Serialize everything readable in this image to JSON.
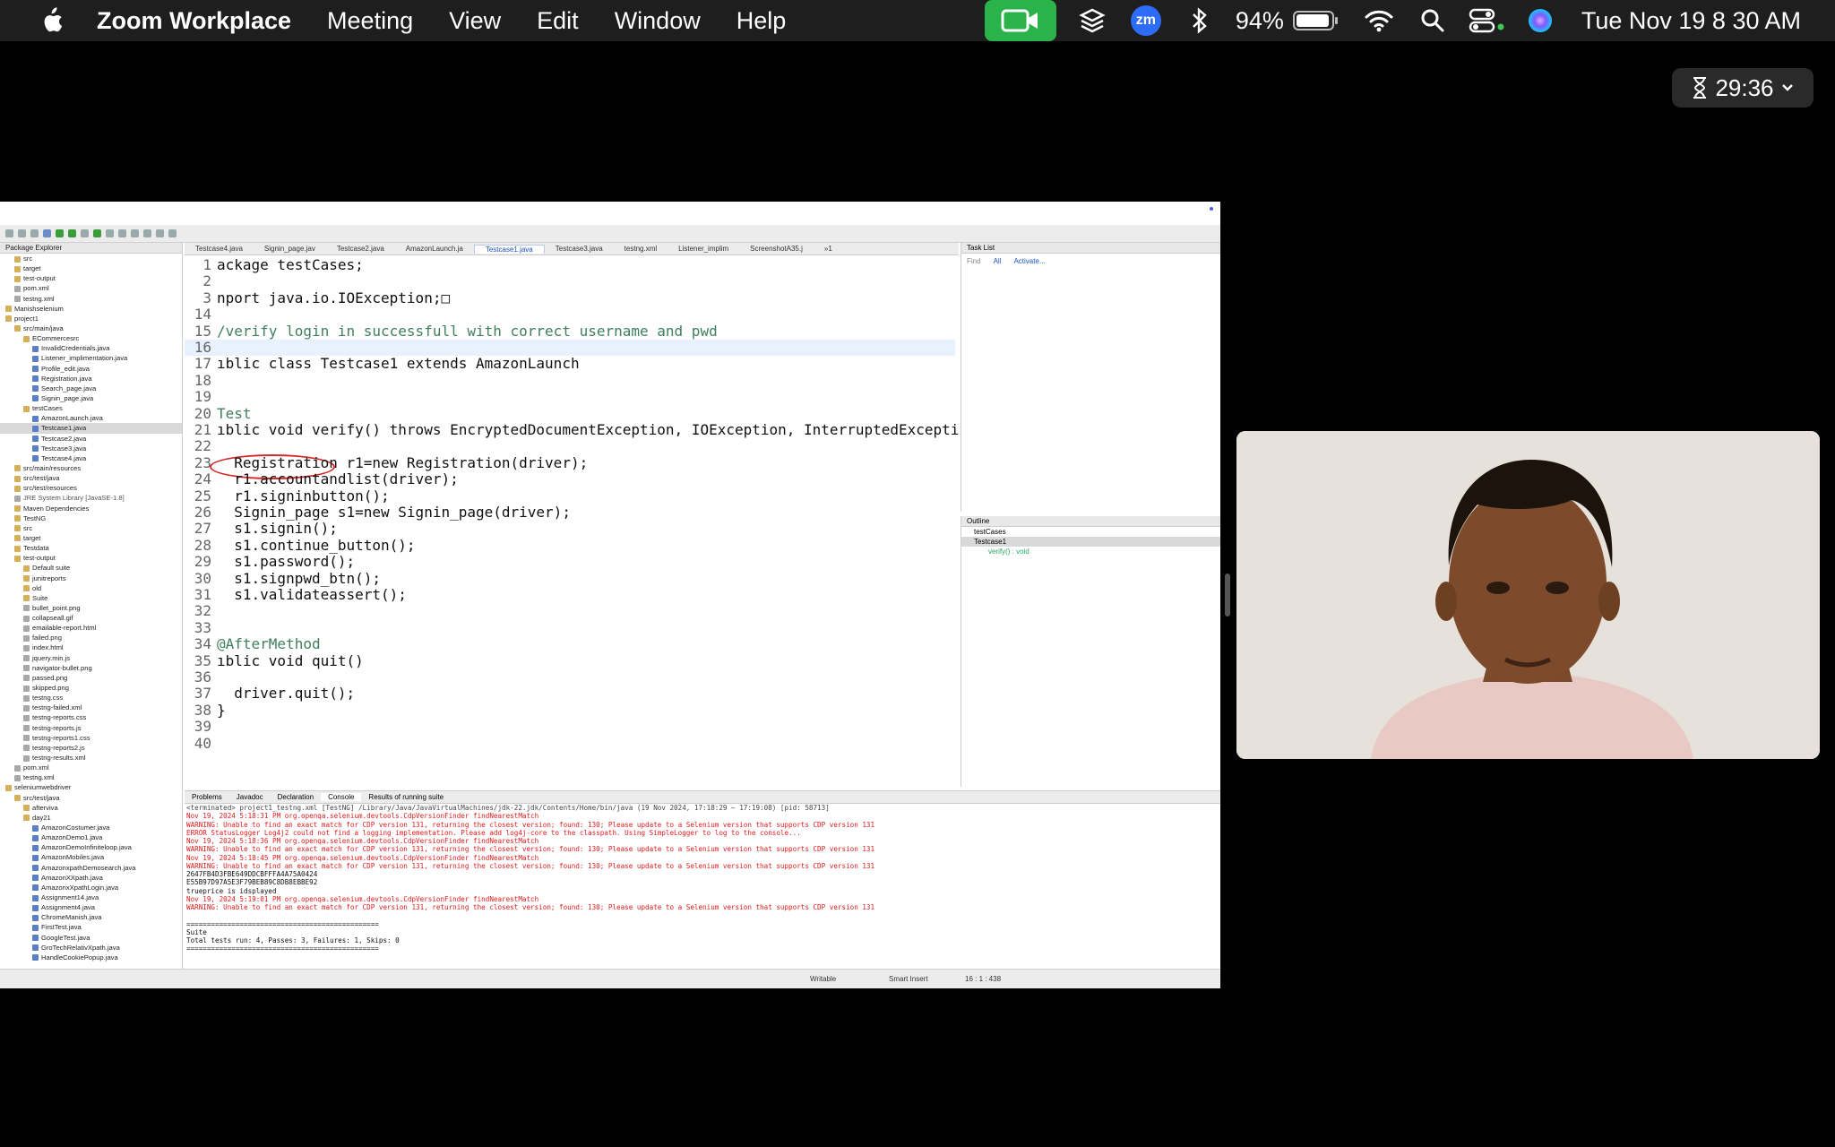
{
  "menubar": {
    "app": "Zoom Workplace",
    "items": [
      "Meeting",
      "View",
      "Edit",
      "Window",
      "Help"
    ],
    "battery": "94%",
    "datetime": "Tue Nov 19  8 30 AM",
    "zm_label": "zm"
  },
  "timer": {
    "value": "29:36"
  },
  "editor": {
    "tabs": [
      "Testcase4.java",
      "Signin_page.jav",
      "Testcase2.java",
      "AmazonLaunch.ja",
      "Testcase1.java",
      "Testcase3.java",
      "testng.xml",
      "Listener_implim",
      "ScreenshotA35.j",
      "»1"
    ],
    "active_tab": "Testcase1.java",
    "lines": [
      {
        "n": "1",
        "t": "ackage testCases;"
      },
      {
        "n": "2",
        "t": ""
      },
      {
        "n": "3",
        "t": "nport java.io.IOException;□"
      },
      {
        "n": "14",
        "t": ""
      },
      {
        "n": "15",
        "t": "/verify login in successfull with correct username and pwd"
      },
      {
        "n": "16",
        "t": ""
      },
      {
        "n": "17",
        "t": "ıblic class Testcase1 extends AmazonLaunch"
      },
      {
        "n": "18",
        "t": ""
      },
      {
        "n": "19",
        "t": ""
      },
      {
        "n": "20",
        "t": "Test"
      },
      {
        "n": "21",
        "t": "ıblic void verify() throws EncryptedDocumentException, IOException, InterruptedExcepti"
      },
      {
        "n": "22",
        "t": ""
      },
      {
        "n": "23",
        "t": "  Registration r1=new Registration(driver);"
      },
      {
        "n": "24",
        "t": "  r1.accountandlist(driver);"
      },
      {
        "n": "25",
        "t": "  r1.signinbutton();"
      },
      {
        "n": "26",
        "t": "  Signin_page s1=new Signin_page(driver);"
      },
      {
        "n": "27",
        "t": "  s1.signin();"
      },
      {
        "n": "28",
        "t": "  s1.continue_button();"
      },
      {
        "n": "29",
        "t": "  s1.password();"
      },
      {
        "n": "30",
        "t": "  s1.signpwd_btn();"
      },
      {
        "n": "31",
        "t": "  s1.validateassert();"
      },
      {
        "n": "32",
        "t": ""
      },
      {
        "n": "33",
        "t": ""
      },
      {
        "n": "34",
        "t": "@AfterMethod"
      },
      {
        "n": "35",
        "t": "ıblic void quit()"
      },
      {
        "n": "36",
        "t": ""
      },
      {
        "n": "37",
        "t": "  driver.quit();"
      },
      {
        "n": "38",
        "t": "}"
      },
      {
        "n": "39",
        "t": ""
      },
      {
        "n": "40",
        "t": ""
      }
    ]
  },
  "package_explorer": {
    "title": "Package Explorer",
    "items": [
      "src",
      "target",
      "test-output",
      "pom.xml",
      "testng.xml",
      "Manishselenium",
      "project1",
      "src/main/java",
      "ECommercesrc",
      "InvalidCredentials.java",
      "Listener_implimentation.java",
      "Profile_edit.java",
      "Registration.java",
      "Search_page.java",
      "Signin_page.java",
      "testCases",
      "AmazonLaunch.java",
      "Testcase1.java",
      "Testcase2.java",
      "Testcase3.java",
      "Testcase4.java",
      "src/main/resources",
      "src/test/java",
      "src/test/resources",
      "JRE System Library [JavaSE-1.8]",
      "Maven Dependencies",
      "TestNG",
      "src",
      "target",
      "Testdata",
      "test-output",
      "Default suite",
      "junitreports",
      "old",
      "Suite",
      "bullet_point.png",
      "collapseall.gif",
      "emailable-report.html",
      "failed.png",
      "index.html",
      "jquery.min.js",
      "navigator-bullet.png",
      "passed.png",
      "skipped.png",
      "testng.css",
      "testng-failed.xml",
      "testng-reports.css",
      "testng-reports.js",
      "testng-reports1.css",
      "testng-reports2.js",
      "testng-results.xml",
      "pom.xml",
      "testng.xml",
      "seleniumwebdriver",
      "src/test/java",
      "afterviva",
      "day21",
      "AmazonCostumer.java",
      "AmazonDemo1.java",
      "AmazonDemoInfiniteloop.java",
      "AmazonMobiles.java",
      "AmazonxpathDemosearch.java",
      "AmazonXXpath.java",
      "AmazonxXpathLogin.java",
      "Assignment14.java",
      "Assignment4.java",
      "ChromeManish.java",
      "FirstTest.java",
      "GoogleTest.java",
      "GroTechRelativXpath.java",
      "HandleCookiePopup.java"
    ]
  },
  "console": {
    "tabs": [
      "Problems",
      "Javadoc",
      "Declaration",
      "Console",
      "Results of running suite"
    ],
    "header": "<terminated> project1_testng.xml [TestNG] /Library/Java/JavaVirtualMachines/jdk-22.jdk/Contents/Home/bin/java (19 Nov 2024, 17:18:29 – 17:19:08) [pid: 58713]",
    "lines": [
      {
        "c": "red",
        "t": "Nov 19, 2024 5:18:31 PM org.openqa.selenium.devtools.CdpVersionFinder findNearestMatch"
      },
      {
        "c": "red",
        "t": "WARNING: Unable to find an exact match for CDP version 131, returning the closest version; found: 130; Please update to a Selenium version that supports CDP version 131"
      },
      {
        "c": "red",
        "t": "ERROR StatusLogger Log4j2 could not find a logging implementation. Please add log4j-core to the classpath. Using SimpleLogger to log to the console..."
      },
      {
        "c": "red",
        "t": "Nov 19, 2024 5:18:36 PM org.openqa.selenium.devtools.CdpVersionFinder findNearestMatch"
      },
      {
        "c": "red",
        "t": "WARNING: Unable to find an exact match for CDP version 131, returning the closest version; found: 130; Please update to a Selenium version that supports CDP version 131"
      },
      {
        "c": "red",
        "t": "Nov 19, 2024 5:18:45 PM org.openqa.selenium.devtools.CdpVersionFinder findNearestMatch"
      },
      {
        "c": "red",
        "t": "WARNING: Unable to find an exact match for CDP version 131, returning the closest version; found: 130; Please update to a Selenium version that supports CDP version 131"
      },
      {
        "c": "blk",
        "t": "2647FB4D3FBE649DDCBFFFA4A75A0424"
      },
      {
        "c": "blk",
        "t": "E55B97D97A5E3F79BEB89C8DB8EBBE92"
      },
      {
        "c": "blk",
        "t": "trueprice is idsplayed"
      },
      {
        "c": "red",
        "t": "Nov 19, 2024 5:19:01 PM org.openqa.selenium.devtools.CdpVersionFinder findNearestMatch"
      },
      {
        "c": "red",
        "t": "WARNING: Unable to find an exact match for CDP version 131, returning the closest version; found: 130; Please update to a Selenium version that supports CDP version 131"
      },
      {
        "c": "blk",
        "t": ""
      },
      {
        "c": "blk",
        "t": "==============================================="
      },
      {
        "c": "blk",
        "t": "Suite"
      },
      {
        "c": "blk",
        "t": "Total tests run: 4, Passes: 3, Failures: 1, Skips: 0"
      },
      {
        "c": "blk",
        "t": "==============================================="
      }
    ]
  },
  "task_list": {
    "title": "Task List",
    "find": "Find",
    "all": "All",
    "activate": "Activate..."
  },
  "outline": {
    "title": "Outline",
    "items": [
      "testCases",
      "Testcase1",
      "verify() : void"
    ]
  },
  "status": {
    "writable": "Writable",
    "insert": "Smart Insert",
    "pos": "16 : 1 : 438"
  }
}
